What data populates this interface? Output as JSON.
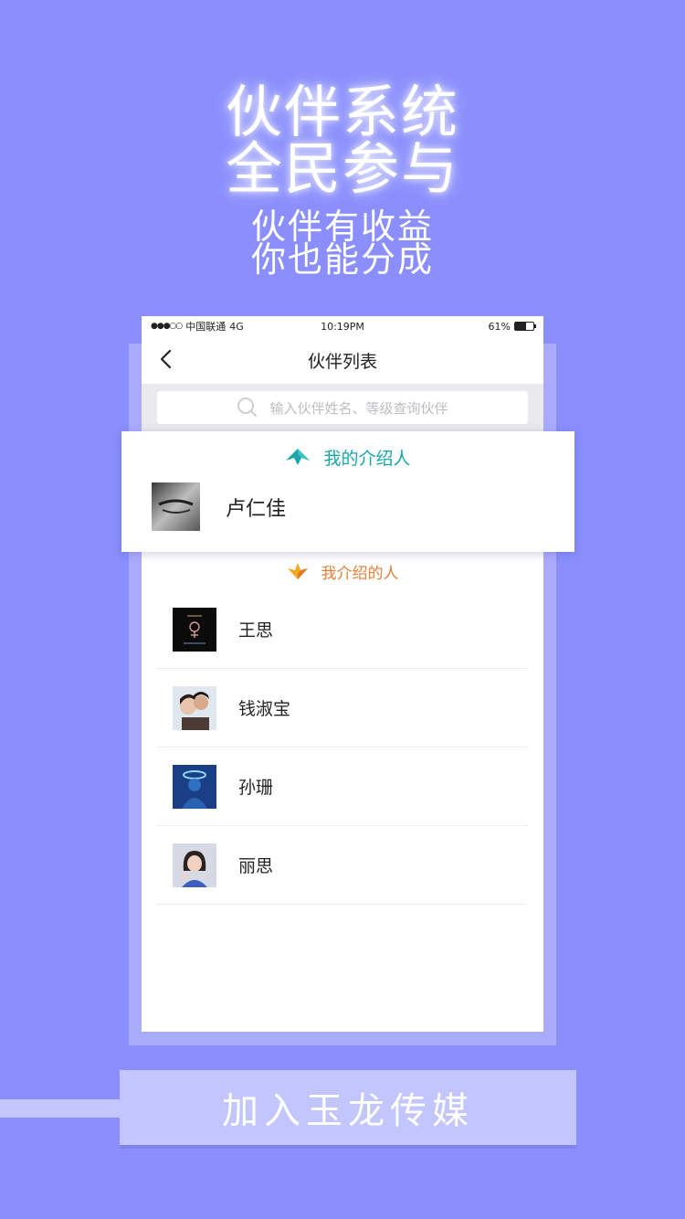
{
  "headline": {
    "line1": "伙伴系统",
    "line2": "全民参与"
  },
  "subline": {
    "line1": "伙伴有收益",
    "line2": "你也能分成"
  },
  "status_bar": {
    "carrier": "中国联通",
    "network": "4G",
    "time": "10:19PM",
    "battery": "61%",
    "battery_level": 0.61
  },
  "nav": {
    "title": "伙伴列表"
  },
  "search": {
    "placeholder": "输入伙伴姓名、等级查询伙伴"
  },
  "introducer": {
    "header": "我的介绍人",
    "name": "卢仁佳"
  },
  "referrals": {
    "header": "我介绍的人",
    "items": [
      {
        "name": "王思"
      },
      {
        "name": "钱淑宝"
      },
      {
        "name": "孙珊"
      },
      {
        "name": "丽思"
      }
    ]
  },
  "join_button": {
    "label": "加入玉龙传媒"
  },
  "colors": {
    "background": "#8a8ffd",
    "introducer_accent": "#1aa6a8",
    "referral_accent": "#e7813a",
    "button_bg": "#c3c6fd"
  }
}
